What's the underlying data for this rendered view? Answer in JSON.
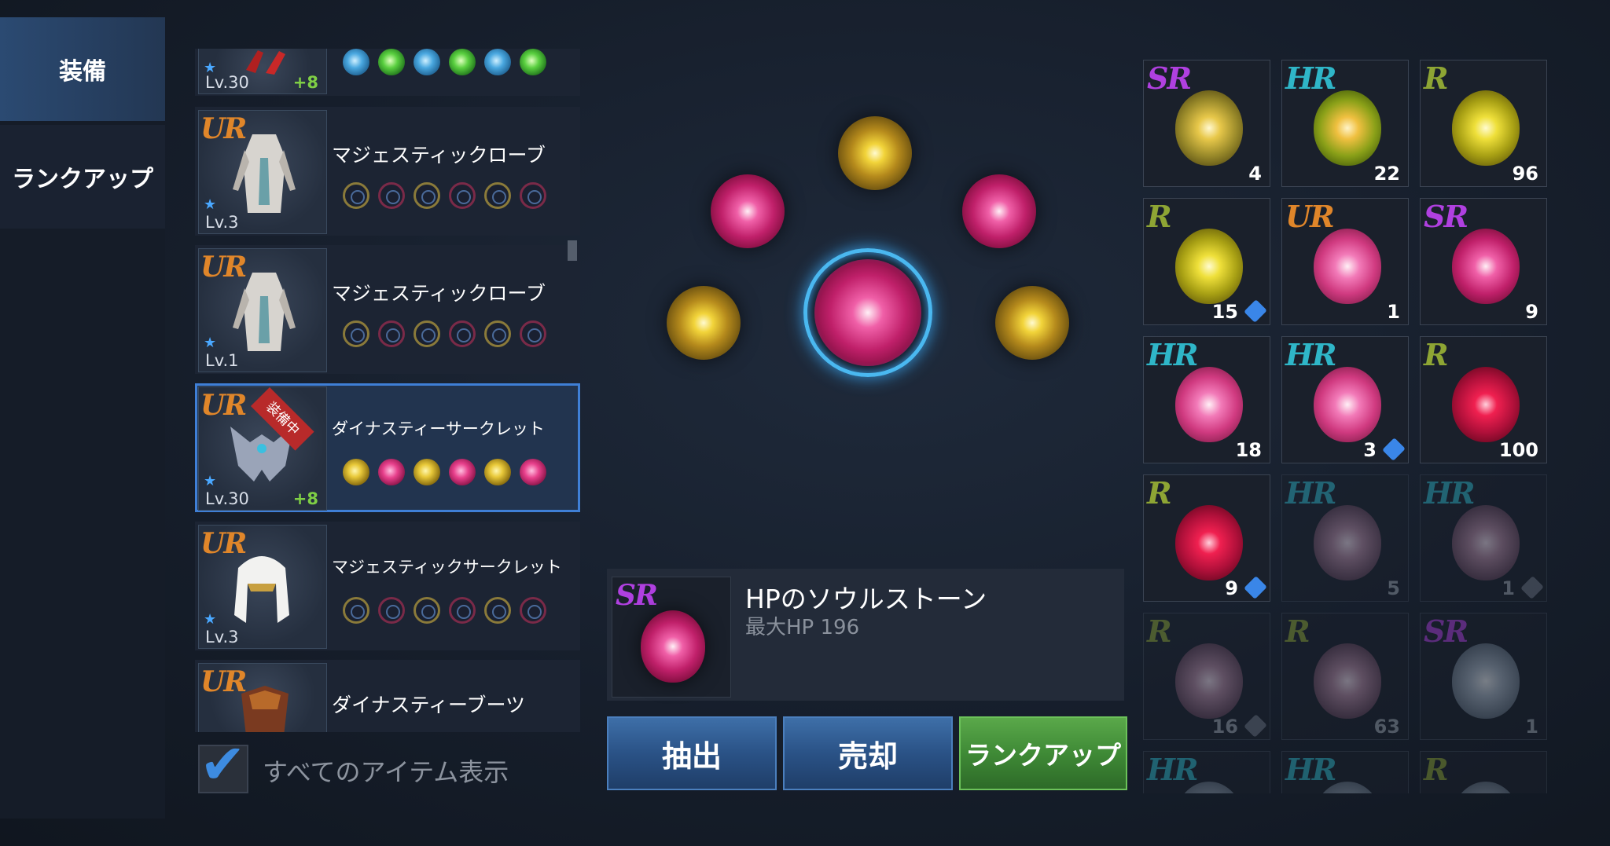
{
  "tabs": {
    "equip": "装備",
    "rankup": "ランクアップ"
  },
  "list": {
    "top_row": {
      "level": "Lv.30",
      "plus": "+8"
    },
    "items": [
      {
        "rarity": "UR",
        "name": "マジェスティックローブ",
        "level": "Lv.3"
      },
      {
        "rarity": "UR",
        "name": "マジェスティックローブ",
        "level": "Lv.1"
      },
      {
        "rarity": "UR",
        "name": "ダイナスティーサークレット",
        "level": "Lv.30",
        "plus": "+8",
        "badge": "装備中"
      },
      {
        "rarity": "UR",
        "name": "マジェスティックサークレット",
        "level": "Lv.3"
      },
      {
        "rarity": "UR",
        "name": "ダイナスティーブーツ"
      }
    ],
    "show_all_label": "すべてのアイテム表示",
    "show_all_checked": true
  },
  "detail": {
    "rarity": "SR",
    "name": "HPのソウルストーン",
    "stat": "最大HP 196"
  },
  "buttons": {
    "extract": "抽出",
    "sell": "売却",
    "rankup": "ランクアップ"
  },
  "inventory": [
    {
      "rarity": "SR",
      "count": "4"
    },
    {
      "rarity": "HR",
      "count": "22"
    },
    {
      "rarity": "R",
      "count": "96"
    },
    {
      "rarity": "R",
      "count": "15"
    },
    {
      "rarity": "UR",
      "count": "1"
    },
    {
      "rarity": "SR",
      "count": "9"
    },
    {
      "rarity": "HR",
      "count": "18"
    },
    {
      "rarity": "HR",
      "count": "3"
    },
    {
      "rarity": "R",
      "count": "100"
    },
    {
      "rarity": "R",
      "count": "9"
    },
    {
      "rarity": "HR",
      "count": "5"
    },
    {
      "rarity": "HR",
      "count": "1"
    },
    {
      "rarity": "R",
      "count": "16"
    },
    {
      "rarity": "R",
      "count": "63"
    },
    {
      "rarity": "SR",
      "count": "1"
    },
    {
      "rarity": "HR",
      "count": ""
    },
    {
      "rarity": "HR",
      "count": ""
    },
    {
      "rarity": "R",
      "count": ""
    }
  ],
  "colors": {
    "ur": "#e0862a",
    "sr": "#b040e0",
    "hr": "#2fb6c8",
    "r": "#8ea534",
    "selection": "#3f7fd6",
    "ring": "#4ab8f0",
    "button_blue": "#2a5286",
    "button_green": "#3f8a36"
  }
}
